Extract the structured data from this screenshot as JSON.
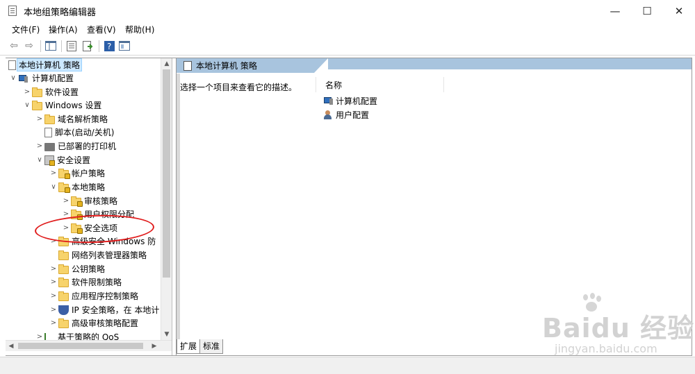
{
  "window": {
    "title": "本地组策略编辑器",
    "minimize_glyph": "—",
    "maximize_glyph": "☐",
    "close_glyph": "✕"
  },
  "menu": [
    "文件(F)",
    "操作(A)",
    "查看(V)",
    "帮助(H)"
  ],
  "toolbar_icons": [
    "back-arrow-icon",
    "forward-arrow-icon",
    "show-tree-icon",
    "properties-icon",
    "export-icon",
    "help-icon",
    "view-icon"
  ],
  "tree": {
    "root": "本地计算机 策略",
    "computer_config": "计算机配置",
    "software_settings": "软件设置",
    "windows_settings": "Windows 设置",
    "name_resolution": "域名解析策略",
    "scripts": "脚本(启动/关机)",
    "printers": "已部署的打印机",
    "security_settings": "安全设置",
    "account_policies": "帐户策略",
    "local_policies": "本地策略",
    "audit_policy": "审核策略",
    "user_rights": "用户权限分配",
    "security_options": "安全选项",
    "windows_firewall": "高级安全 Windows 防",
    "network_list": "网络列表管理器策略",
    "public_key": "公钥策略",
    "software_restriction": "软件限制策略",
    "app_control": "应用程序控制策略",
    "ip_security": "IP 安全策略，在 本地计",
    "advanced_audit": "高级审核策略配置",
    "qos": "基于策略的 QoS"
  },
  "right_pane": {
    "header": "本地计算机 策略",
    "description": "选择一个项目来查看它的描述。",
    "column_name": "名称",
    "items": [
      "计算机配置",
      "用户配置"
    ]
  },
  "tabs": [
    "扩展",
    "标准"
  ],
  "watermark": {
    "logo": "Baidu 经验",
    "url": "jingyan.baidu.com"
  }
}
